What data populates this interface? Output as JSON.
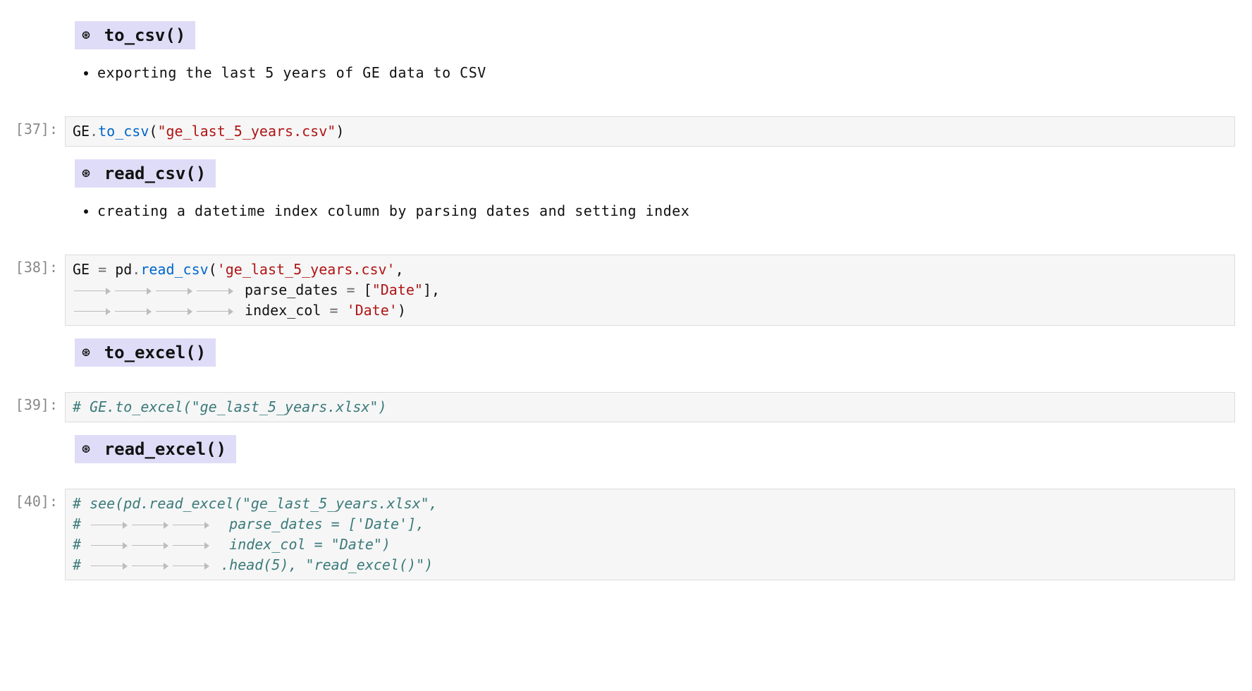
{
  "prompts": {
    "c37": "[37]:",
    "c38": "[38]:",
    "c39": "[39]:",
    "c40": "[40]:"
  },
  "sections": {
    "to_csv": {
      "heading": "to_csv()",
      "bullet": "exporting the last 5 years of GE data to CSV"
    },
    "read_csv": {
      "heading": "read_csv()",
      "bullet": "creating a datetime index column by parsing dates and setting index"
    },
    "to_excel": {
      "heading": "to_excel()"
    },
    "read_excel": {
      "heading": "read_excel()"
    }
  },
  "code": {
    "c37": {
      "obj": "GE",
      "dot": ".",
      "func": "to_csv",
      "paren_open": "(",
      "str": "\"ge_last_5_years.csv\"",
      "paren_close": ")"
    },
    "c38": {
      "line1_lhs": "GE ",
      "line1_eq": "=",
      "line1_obj": " pd",
      "line1_dot": ".",
      "line1_func": "read_csv",
      "line1_open": "(",
      "line1_str": "'ge_last_5_years.csv'",
      "line1_comma": ",",
      "line2_kw": "parse_dates ",
      "line2_eq": "=",
      "line2_list_open": " [",
      "line2_str": "\"Date\"",
      "line2_list_close": "]",
      "line2_comma": ",",
      "line3_kw": "index_col ",
      "line3_eq": "=",
      "line3_sp": " ",
      "line3_str": "'Date'",
      "line3_close": ")"
    },
    "c39": {
      "comment": "# GE.to_excel(\"ge_last_5_years.xlsx\")"
    },
    "c40": {
      "l1": "# see(pd.read_excel(\"ge_last_5_years.xlsx\",",
      "l2_hash": "# ",
      "l2_rest": "  parse_dates = ['Date'],",
      "l3_hash": "# ",
      "l3_rest": "  index_col = \"Date\")",
      "l4_hash": "# ",
      "l4_rest": " .head(5), \"read_excel()\")"
    }
  }
}
